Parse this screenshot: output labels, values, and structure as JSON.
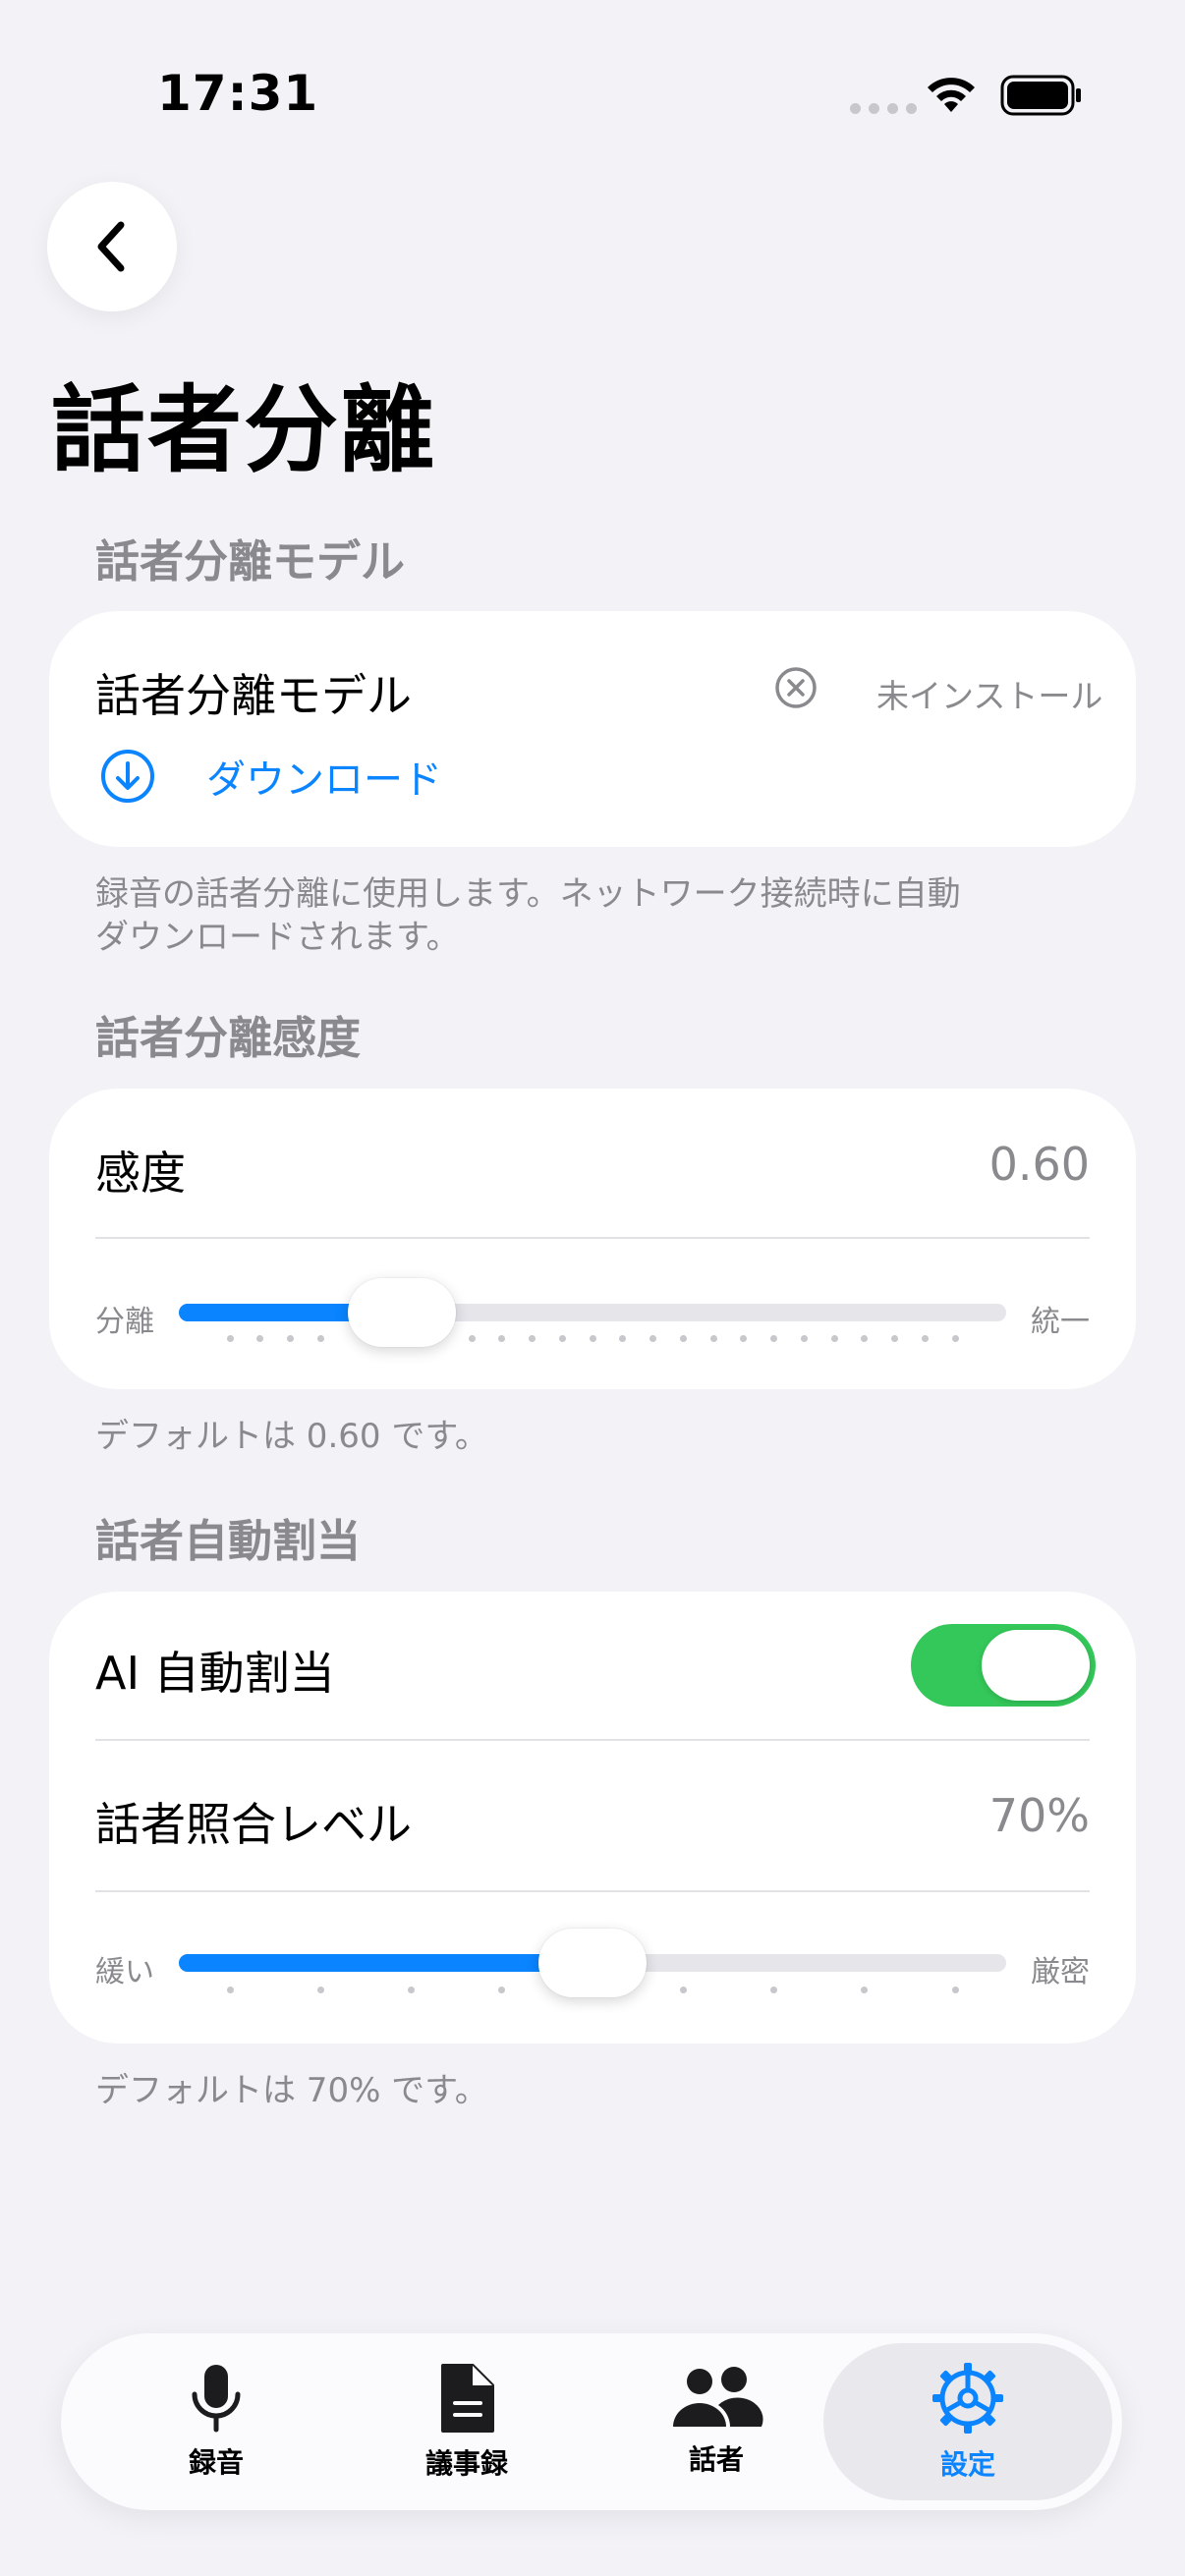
{
  "status_bar": {
    "time": "17:31"
  },
  "page": {
    "title": "話者分離"
  },
  "model_section": {
    "header": "話者分離モデル",
    "row_label": "話者分離モデル",
    "status": "未インストール",
    "download_label": "ダウンロード",
    "footnote_line1": "録音の話者分離に使用します。ネットワーク接続時に自動",
    "footnote_line2": "ダウンロードされます。"
  },
  "sensitivity_section": {
    "header": "話者分離感度",
    "row_label": "感度",
    "value": "0.60",
    "slider_min_label": "分離",
    "slider_max_label": "統一",
    "slider_fraction": 0.27,
    "footnote": "デフォルトは 0.60 です。"
  },
  "auto_assign_section": {
    "header": "話者自動割当",
    "toggle_label": "AI 自動割当",
    "toggle_on": true,
    "match_label": "話者照合レベル",
    "match_value": "70%",
    "slider_min_label": "緩い",
    "slider_max_label": "厳密",
    "slider_fraction": 0.5,
    "footnote": "デフォルトは 70% です。"
  },
  "tab_bar": {
    "tabs": [
      {
        "label": "録音",
        "icon": "microphone-icon",
        "active": false
      },
      {
        "label": "議事録",
        "icon": "document-icon",
        "active": false
      },
      {
        "label": "話者",
        "icon": "people-icon",
        "active": false
      },
      {
        "label": "設定",
        "icon": "gear-icon",
        "active": true
      }
    ]
  },
  "colors": {
    "accent": "#0a84ff",
    "toggle_on": "#34c759",
    "background": "#f2f2f7",
    "secondary_text": "#8a8a8e"
  }
}
